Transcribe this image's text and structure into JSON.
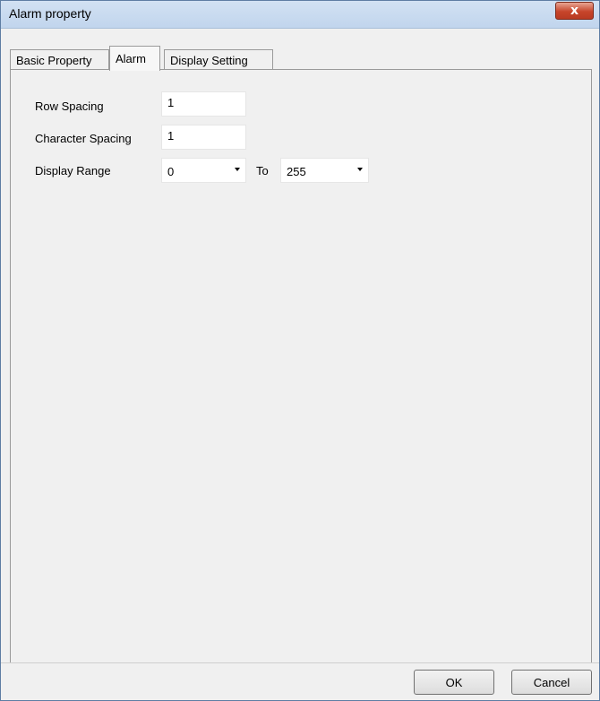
{
  "window": {
    "title": "Alarm property",
    "close_symbol": "x"
  },
  "tabs": [
    {
      "label": "Basic Property",
      "active": false
    },
    {
      "label": "Alarm",
      "active": true
    },
    {
      "label": "Display Setting",
      "active": false
    }
  ],
  "form": {
    "row_spacing": {
      "label": "Row Spacing",
      "value": "1"
    },
    "character_spacing": {
      "label": "Character Spacing",
      "value": "1"
    },
    "display_range": {
      "label": "Display Range",
      "from": "0",
      "to_label": "To",
      "to": "255"
    }
  },
  "buttons": {
    "ok": "OK",
    "cancel": "Cancel"
  }
}
